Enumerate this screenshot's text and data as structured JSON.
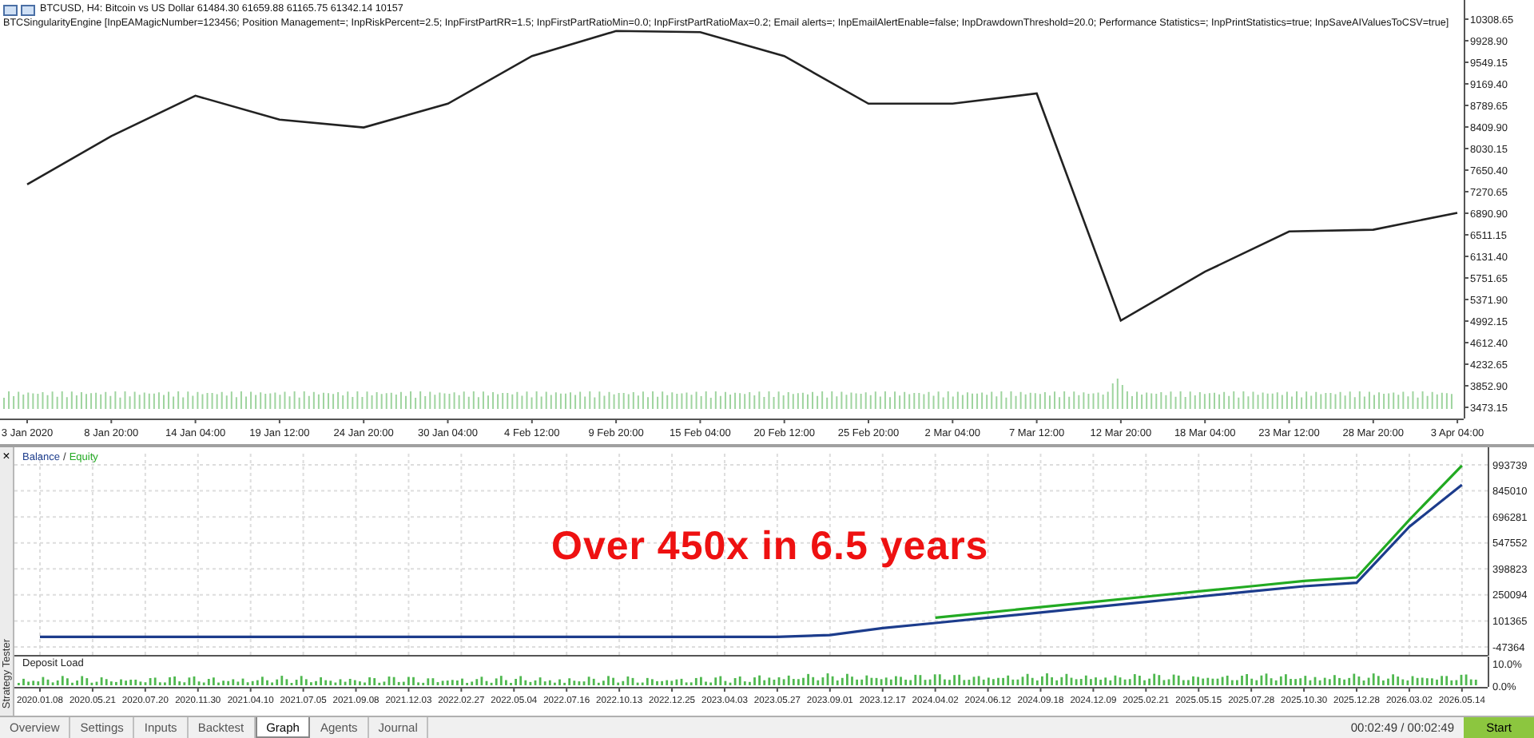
{
  "chart_header": {
    "symbol_line": "BTCUSD, H4:  Bitcoin vs US Dollar  61484.30 61659.88 61165.75 61342.14  10157",
    "expert_line": "BTCSingularityEngine [InpEAMagicNumber=123456; Position Management=; InpRiskPercent=2.5; InpFirstPartRR=1.5; InpFirstPartRatioMin=0.0; InpFirstPartRatioMax=0.2; Email alerts=; InpEmailAlertEnable=false; InpDrawdownThreshold=20.0; Performance Statistics=; InpPrintStatistics=true; InpSaveAIValuesToCSV=true]"
  },
  "price_chart": {
    "chart_data": {
      "type": "line",
      "categories": [
        "3 Jan 2020",
        "8 Jan 20:00",
        "14 Jan 04:00",
        "19 Jan 12:00",
        "24 Jan 20:00",
        "30 Jan 04:00",
        "4 Feb 12:00",
        "9 Feb 20:00",
        "15 Feb 04:00",
        "20 Feb 12:00",
        "25 Feb 20:00",
        "2 Mar 04:00",
        "7 Mar 12:00",
        "12 Mar 20:00",
        "18 Mar 04:00",
        "23 Mar 12:00",
        "28 Mar 20:00",
        "3 Apr 04:00"
      ],
      "series": [
        {
          "color": "#222222",
          "values": [
            7400,
            8250,
            8960,
            8540,
            8400,
            8820,
            9660,
            10100,
            10080,
            9660,
            8820,
            8820,
            9000,
            5000,
            5860,
            6570,
            6600,
            6900
          ]
        }
      ],
      "ylim": [
        3276,
        10646
      ],
      "yticks": [
        {
          "value": 10308.65,
          "label": "10308.65"
        },
        {
          "value": 9928.9,
          "label": "9928.90"
        },
        {
          "value": 9549.15,
          "label": "9549.15"
        },
        {
          "value": 9169.4,
          "label": "9169.40"
        },
        {
          "value": 8789.65,
          "label": "8789.65"
        },
        {
          "value": 8409.9,
          "label": "8409.90"
        },
        {
          "value": 8030.15,
          "label": "8030.15"
        },
        {
          "value": 7650.4,
          "label": "7650.40"
        },
        {
          "value": 7270.65,
          "label": "7270.65"
        },
        {
          "value": 6890.9,
          "label": "6890.90"
        },
        {
          "value": 6511.15,
          "label": "6511.15"
        },
        {
          "value": 6131.4,
          "label": "6131.40"
        },
        {
          "value": 5751.65,
          "label": "5751.65"
        },
        {
          "value": 5371.9,
          "label": "5371.90"
        },
        {
          "value": 4992.15,
          "label": "4992.15"
        },
        {
          "value": 4612.4,
          "label": "4612.40"
        },
        {
          "value": 4232.65,
          "label": "4232.65"
        },
        {
          "value": 3852.9,
          "label": "3852.90"
        },
        {
          "value": 3473.15,
          "label": "3473.15"
        }
      ]
    }
  },
  "graph_panel": {
    "legend_separator": "/",
    "headline": "Over 450x in 6.5 years",
    "chart_data": {
      "type": "line",
      "categories": [
        "2020.01.08",
        "2020.05.21",
        "2020.07.20",
        "2020.11.30",
        "2021.04.10",
        "2021.07.05",
        "2021.09.08",
        "2021.12.03",
        "2022.02.27",
        "2022.05.04",
        "2022.07.16",
        "2022.10.13",
        "2022.12.25",
        "2023.04.03",
        "2023.05.27",
        "2023.09.01",
        "2023.12.17",
        "2024.04.02",
        "2024.06.12",
        "2024.09.18",
        "2024.12.09",
        "2025.02.21",
        "2025.05.15",
        "2025.07.28",
        "2025.10.30",
        "2025.12.28",
        "2026.03.02",
        "2026.05.14"
      ],
      "series": [
        {
          "name": "Balance",
          "color": "#1c3c8c",
          "values": [
            10000,
            10000,
            10000,
            10000,
            10000,
            10000,
            10000,
            10000,
            10000,
            10000,
            10000,
            10000,
            10000,
            10000,
            10000,
            20000,
            60000,
            90000,
            120000,
            150000,
            180000,
            210000,
            240000,
            270000,
            300000,
            320000,
            640000,
            880000
          ]
        },
        {
          "name": "Equity",
          "color": "#22aa22",
          "values": [
            null,
            null,
            null,
            null,
            null,
            null,
            null,
            null,
            null,
            null,
            null,
            null,
            null,
            null,
            null,
            null,
            null,
            120000,
            150000,
            180000,
            210000,
            240000,
            270000,
            300000,
            330000,
            350000,
            680000,
            990000
          ]
        }
      ],
      "grid": true,
      "ylim": [
        -97594,
        1094197
      ],
      "yticks": [
        993739,
        845010,
        696281,
        547552,
        398823,
        250094,
        101365,
        -47364
      ]
    }
  },
  "deposit_load": {
    "title": "Deposit Load",
    "top_label": "10.0%",
    "bottom_label": "0.0%"
  },
  "side_tab": {
    "close": "×",
    "label": "Strategy Tester"
  },
  "tabs": [
    {
      "label": "Overview",
      "selected": false
    },
    {
      "label": "Settings",
      "selected": false
    },
    {
      "label": "Inputs",
      "selected": false
    },
    {
      "label": "Backtest",
      "selected": false
    },
    {
      "label": "Graph",
      "selected": true
    },
    {
      "label": "Agents",
      "selected": false
    },
    {
      "label": "Journal",
      "selected": false
    }
  ],
  "timer": "00:02:49 / 00:02:49",
  "start_button": "Start"
}
